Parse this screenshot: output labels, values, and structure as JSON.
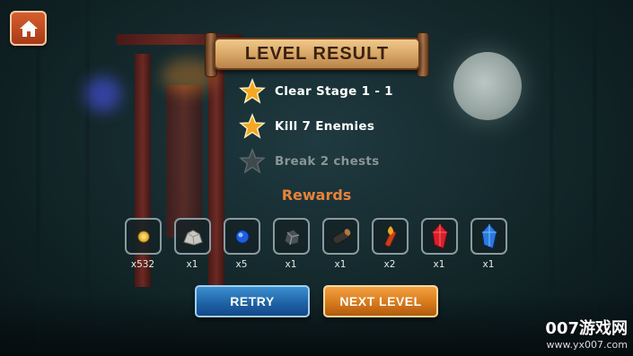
{
  "title": "LEVEL RESULT",
  "home_icon": "home-icon",
  "objectives": [
    {
      "text": "Clear Stage 1 - 1",
      "completed": true
    },
    {
      "text": "Kill 7 Enemies",
      "completed": true
    },
    {
      "text": "Break 2 chests",
      "completed": false
    }
  ],
  "rewards_title": "Rewards",
  "rewards": [
    {
      "icon": "gold-coin-icon",
      "qty": "x532"
    },
    {
      "icon": "stone-ore-icon",
      "qty": "x1"
    },
    {
      "icon": "blue-gem-icon",
      "qty": "x5"
    },
    {
      "icon": "iron-ore-icon",
      "qty": "x1"
    },
    {
      "icon": "wood-log-icon",
      "qty": "x1"
    },
    {
      "icon": "fire-scroll-icon",
      "qty": "x2"
    },
    {
      "icon": "red-crystal-icon",
      "qty": "x1"
    },
    {
      "icon": "blue-crystal-icon",
      "qty": "x1"
    }
  ],
  "buttons": {
    "retry": "RETRY",
    "next": "NEXT LEVEL"
  },
  "watermark": {
    "top": "007游戏网",
    "bottom": "www.yx007.com"
  },
  "colors": {
    "star_gold": "#f5a623",
    "rewards_title": "#e8823a",
    "retry_blue": "#1f64a6",
    "next_orange": "#d87a1c"
  }
}
